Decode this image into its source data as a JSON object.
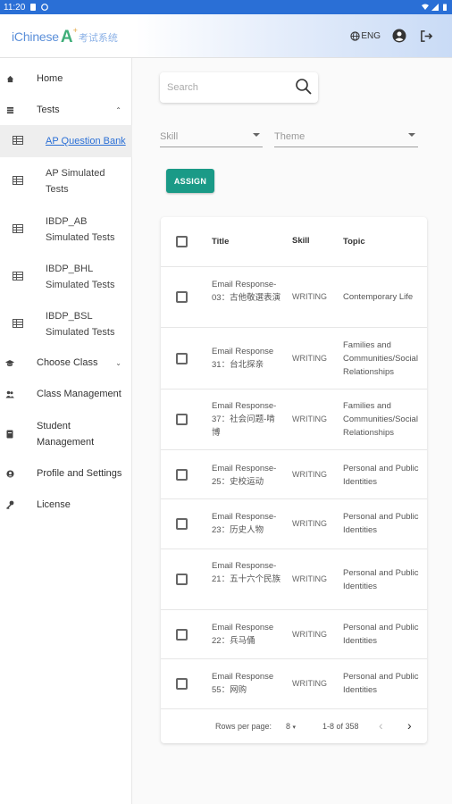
{
  "status_bar": {
    "time": "11:20"
  },
  "header": {
    "logo_text": "iChinese",
    "logo_a": "A",
    "logo_plus": "+",
    "logo_cn": "考试系统",
    "lang_label": "ENG",
    "icons": [
      "globe-icon",
      "account-circle-icon",
      "logout-icon"
    ]
  },
  "sidebar": {
    "home": "Home",
    "tests": "Tests",
    "sub": [
      {
        "label": "AP Question Bank"
      },
      {
        "label": "AP Simulated Tests"
      },
      {
        "label": "IBDP_AB Simulated Tests"
      },
      {
        "label": "IBDP_BHL Simulated Tests"
      },
      {
        "label": "IBDP_BSL Simulated Tests"
      }
    ],
    "choose_class": "Choose Class",
    "class_management": "Class Management",
    "student_management": "Student Management",
    "profile_settings": "Profile and Settings",
    "license": "License"
  },
  "search": {
    "placeholder": "Search"
  },
  "filters": {
    "skill": "Skill",
    "theme": "Theme"
  },
  "assign_label": "ASSIGN",
  "table": {
    "columns": {
      "title": "Title",
      "skill": "Skill",
      "topic": "Topic"
    },
    "rows": [
      {
        "title": "Email Response-03：古他敬選表演",
        "skill": "WRITING",
        "topic": "Contemporary Life"
      },
      {
        "title": "Email Response 31：台北探亲",
        "skill": "WRITING",
        "topic": "Families and Communities/Social Relationships"
      },
      {
        "title": "Email Response-37：社会问题-啃博",
        "skill": "WRITING",
        "topic": "Families and Communities/Social Relationships"
      },
      {
        "title": "Email Response-25：史校运动",
        "skill": "WRITING",
        "topic": "Personal and Public Identities"
      },
      {
        "title": "Email Response-23：历史人物",
        "skill": "WRITING",
        "topic": "Personal and Public Identities"
      },
      {
        "title": "Email Response-21：五十六个民族",
        "skill": "WRITING",
        "topic": "Personal and Public Identities"
      },
      {
        "title": "Email Response 22：兵马俑",
        "skill": "WRITING",
        "topic": "Personal and Public Identities"
      },
      {
        "title": "Email Response 55：网购",
        "skill": "WRITING",
        "topic": "Personal and Public Identities"
      }
    ],
    "footer": {
      "rows_per_page_label": "Rows per page:",
      "rows_per_page": "8",
      "range": "1-8 of 358"
    }
  },
  "colors": {
    "accent": "#2a6fd6",
    "assign_button": "#1a9a87"
  }
}
